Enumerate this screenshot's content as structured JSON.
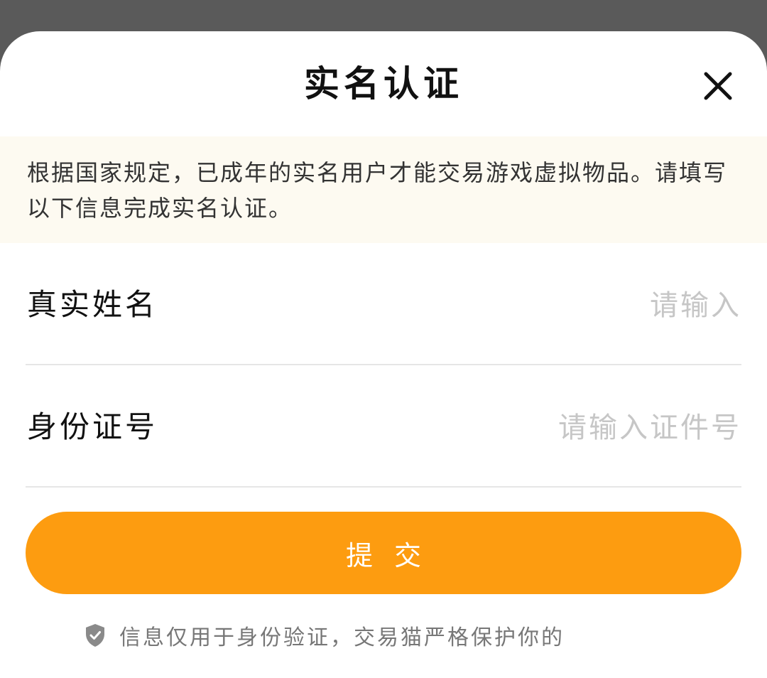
{
  "dialog": {
    "title": "实名认证",
    "close_icon": "close-icon"
  },
  "notice": {
    "text": "根据国家规定，已成年的实名用户才能交易游戏虚拟物品。请填写以下信息完成实名认证。"
  },
  "form": {
    "name": {
      "label": "真实姓名",
      "placeholder": "请输入",
      "value": ""
    },
    "id_number": {
      "label": "身份证号",
      "placeholder": "请输入证件号",
      "value": ""
    }
  },
  "submit": {
    "label": "提交"
  },
  "footer": {
    "icon": "shield-check-icon",
    "text": "信息仅用于身份验证，交易猫严格保护你的"
  },
  "colors": {
    "accent": "#fd9c10",
    "notice_bg": "#fdfaf1",
    "overlay": "#5a5a5a",
    "placeholder": "#c6c6c6"
  }
}
